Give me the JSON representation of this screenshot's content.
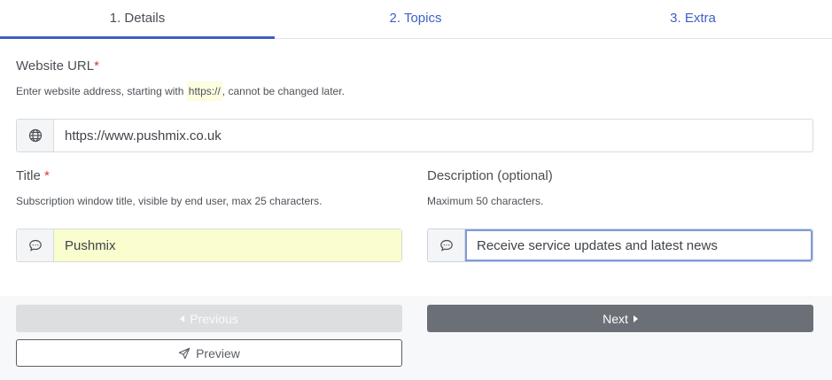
{
  "tabs": [
    {
      "label": "1. Details"
    },
    {
      "label": "2. Topics"
    },
    {
      "label": "3. Extra"
    }
  ],
  "website_url": {
    "label": "Website URL",
    "required_mark": "*",
    "help_before": "Enter website address, starting with ",
    "help_code": "https://",
    "help_after": ", cannot be changed later.",
    "value": "https://www.pushmix.co.uk",
    "icon": "globe-icon"
  },
  "title": {
    "label": "Title",
    "required_mark": "*",
    "help": "Subscription window title, visible by end user, max 25 characters.",
    "value": "Pushmix",
    "icon": "chat-bubble-icon"
  },
  "description": {
    "label": "Description (optional)",
    "help": "Maximum 50 characters.",
    "value": "Receive service updates and latest news",
    "icon": "chat-bubble-icon"
  },
  "buttons": {
    "previous": "Previous",
    "next": "Next",
    "preview": "Preview"
  },
  "colors": {
    "accent": "#3d5ec1",
    "required": "#d43b3b",
    "highlight": "#fafdcd",
    "next_button": "#6b7077"
  }
}
